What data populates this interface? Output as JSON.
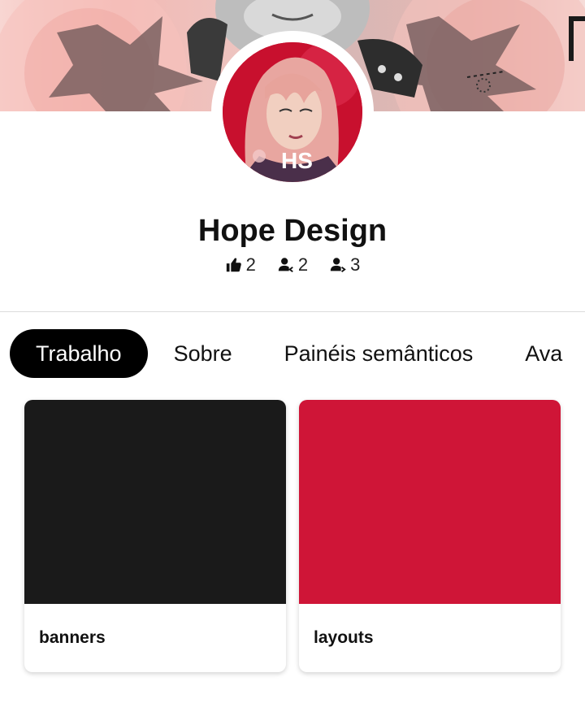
{
  "profile": {
    "name": "Hope Design",
    "avatar_badge": "HS",
    "stats": [
      {
        "icon": "thumbs-up-icon",
        "value": "2"
      },
      {
        "icon": "follower-icon",
        "value": "2"
      },
      {
        "icon": "following-icon",
        "value": "3"
      }
    ]
  },
  "tabs": [
    {
      "label": "Trabalho",
      "active": true
    },
    {
      "label": "Sobre",
      "active": false
    },
    {
      "label": "Painéis semânticos",
      "active": false
    },
    {
      "label": "Ava",
      "active": false
    }
  ],
  "works": [
    {
      "label": "banners",
      "color": "#1a1a1a"
    },
    {
      "label": "layouts",
      "color": "#cf1537"
    }
  ],
  "colors": {
    "accent": "#000000",
    "brand_red": "#cf1537"
  }
}
